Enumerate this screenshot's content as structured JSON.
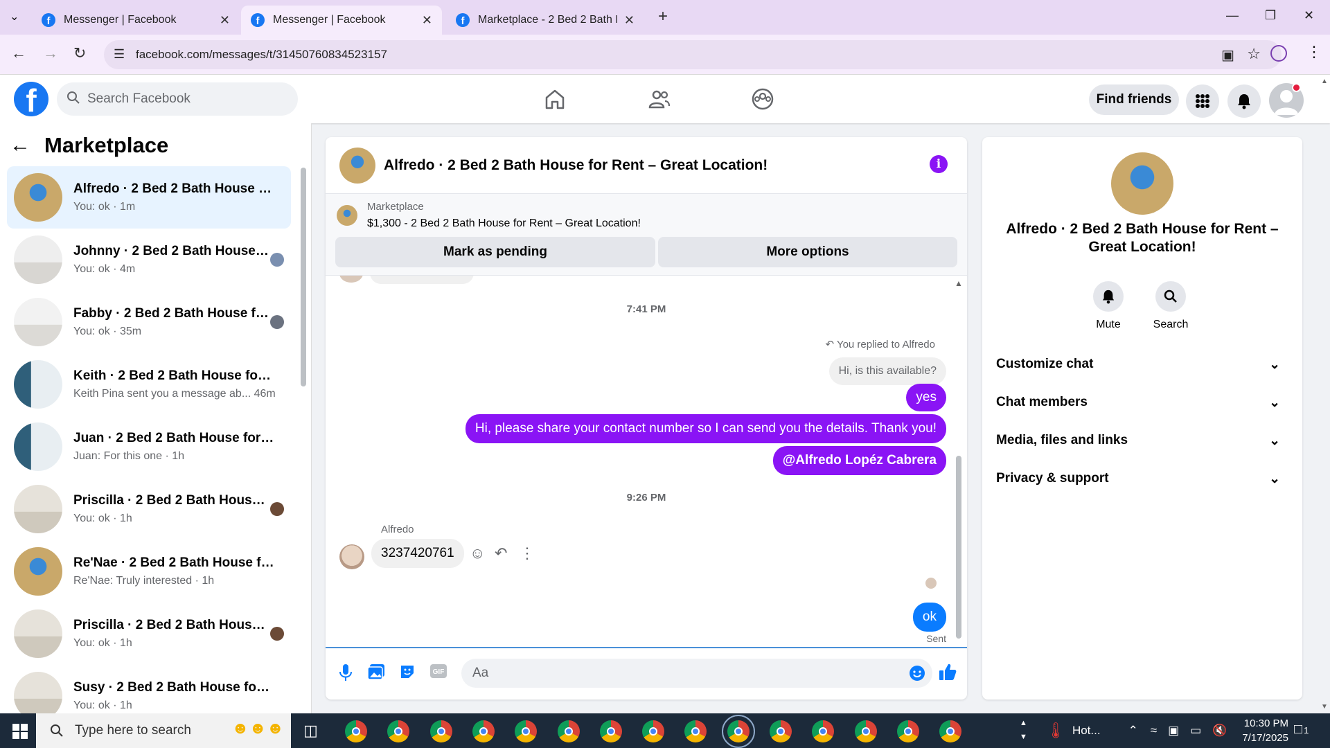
{
  "browser": {
    "tabs": [
      {
        "title": "Messenger | Facebook",
        "active": false
      },
      {
        "title": "Messenger | Facebook",
        "active": true
      },
      {
        "title": "Marketplace - 2 Bed 2 Bath Hou",
        "active": false
      }
    ],
    "url": "facebook.com/messages/t/31450760834523157"
  },
  "fb": {
    "search_placeholder": "Search Facebook",
    "find_friends": "Find friends"
  },
  "sidebar": {
    "title": "Marketplace",
    "conversations": [
      {
        "name": "Alfredo · 2 Bed 2 Bath House for...",
        "preview": "You: ok · 1m",
        "selected": true
      },
      {
        "name": "Johnny · 2 Bed 2 Bath House f...",
        "preview": "You: ok · 4m"
      },
      {
        "name": "Fabby · 2 Bed 2 Bath House fo...",
        "preview": "You: ok · 35m"
      },
      {
        "name": "Keith · 2 Bed 2 Bath House for R...",
        "preview": "Keith Pina sent you a message ab... 46m"
      },
      {
        "name": "Juan · 2 Bed 2 Bath House for R...",
        "preview": "Juan: For this one · 1h"
      },
      {
        "name": "Priscilla · 2 Bed 2 Bath House ...",
        "preview": "You: ok · 1h"
      },
      {
        "name": "Re'Nae · 2 Bed 2 Bath House for ...",
        "preview": "Re'Nae: Truly interested · 1h"
      },
      {
        "name": "Priscilla · 2 Bed 2 Bath House ...",
        "preview": "You: ok · 1h"
      },
      {
        "name": "Susy · 2 Bed 2 Bath House for R...",
        "preview": "You: ok · 1h"
      }
    ]
  },
  "chat": {
    "title": "Alfredo · 2 Bed 2 Bath House for Rent – Great Location!",
    "marketplace_label": "Marketplace",
    "listing": "$1,300 - 2 Bed 2 Bath House for Rent – Great Location!",
    "mark_pending": "Mark as pending",
    "more_options": "More options",
    "time1": "7:41 PM",
    "replied_note": "You replied to Alfredo",
    "quoted": "Hi, is this available?",
    "msg_yes": "yes",
    "msg_share": "Hi, please share your contact number so I can send you the details. Thank you!",
    "msg_mention": "@Alfredo Lopéz Cabrera",
    "time2": "9:26 PM",
    "sender": "Alfredo",
    "msg_phone": "3237420761",
    "msg_ok": "ok",
    "sent_status": "Sent",
    "composer_placeholder": "Aa"
  },
  "rpanel": {
    "title": "Alfredo · 2 Bed 2 Bath House for Rent – Great Location!",
    "mute": "Mute",
    "search": "Search",
    "rows": [
      "Customize chat",
      "Chat members",
      "Media, files and links",
      "Privacy & support"
    ]
  },
  "taskbar": {
    "search_placeholder": "Type here to search",
    "weather": "Hot...",
    "time": "10:30 PM",
    "date": "7/17/2025",
    "notif_count": "1"
  },
  "colors": {
    "accent": "#8a14f5",
    "fb_blue": "#1877f2",
    "message_blue": "#0a7cff"
  }
}
